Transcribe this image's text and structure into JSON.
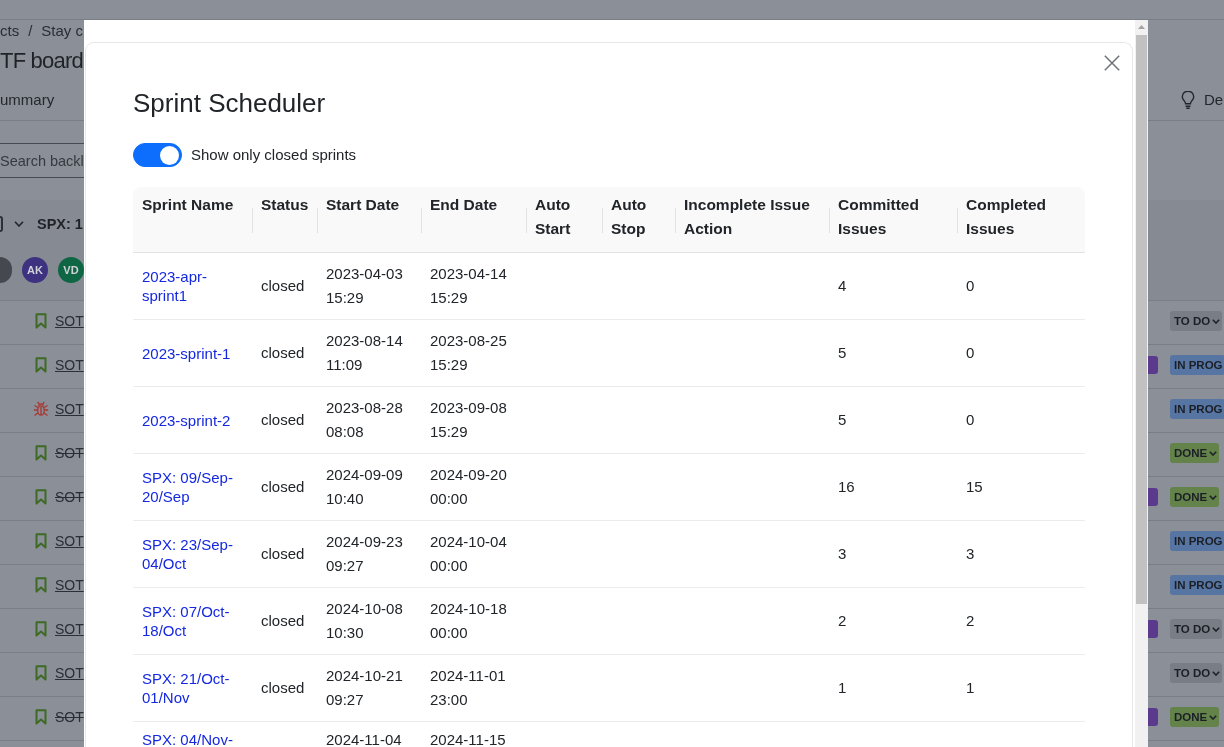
{
  "background_page": {
    "breadcrumb": {
      "items": [
        "cts",
        "Stay c"
      ],
      "separator": "/"
    },
    "board_title": "TF board",
    "nav_tabs": {
      "left": "ummary",
      "right": "De"
    },
    "search": {
      "placeholder": "Search backl"
    },
    "sprint": {
      "title": "SPX: 1",
      "expanded": true,
      "checked": false
    },
    "avatars": [
      {
        "kind": "photo"
      },
      {
        "kind": "initials",
        "initials": "AK",
        "color": "#3d3180"
      },
      {
        "kind": "initials",
        "initials": "VD",
        "color": "#0f6644"
      }
    ],
    "issues": [
      {
        "kind": "story",
        "key": "SOT",
        "done": false,
        "tagged": false,
        "status": {
          "label": "TO DO",
          "color": "#787d86",
          "dropdown": true
        }
      },
      {
        "kind": "story",
        "key": "SOT",
        "done": false,
        "tagged": true,
        "status": {
          "label": "IN PROG",
          "color": "#5675a2",
          "dropdown": false
        }
      },
      {
        "kind": "bug",
        "key": "SOT",
        "done": false,
        "tagged": false,
        "status": {
          "label": "IN PROG",
          "color": "#5675a2",
          "dropdown": false
        }
      },
      {
        "kind": "story",
        "key": "SOT",
        "done": true,
        "tagged": false,
        "status": {
          "label": "DONE",
          "color": "#64834b",
          "dropdown": true
        }
      },
      {
        "kind": "story",
        "key": "SOT",
        "done": true,
        "tagged": true,
        "status": {
          "label": "DONE",
          "color": "#64834b",
          "dropdown": true
        }
      },
      {
        "kind": "story",
        "key": "SOT",
        "done": false,
        "tagged": false,
        "status": {
          "label": "IN PROG",
          "color": "#5675a2",
          "dropdown": false
        }
      },
      {
        "kind": "story",
        "key": "SOT",
        "done": false,
        "tagged": false,
        "status": {
          "label": "IN PROG",
          "color": "#5675a2",
          "dropdown": false
        }
      },
      {
        "kind": "story",
        "key": "SOT",
        "done": false,
        "tagged": true,
        "status": {
          "label": "TO DO",
          "color": "#787d86",
          "dropdown": true
        }
      },
      {
        "kind": "story",
        "key": "SOT",
        "done": false,
        "tagged": false,
        "status": {
          "label": "TO DO",
          "color": "#787d86",
          "dropdown": true
        }
      },
      {
        "kind": "story",
        "key": "SOT",
        "done": true,
        "tagged": true,
        "status": {
          "label": "DONE",
          "color": "#64834b",
          "dropdown": true
        }
      }
    ]
  },
  "modal": {
    "title": "Sprint Scheduler",
    "toggle": {
      "label": "Show only closed sprints",
      "on": true
    },
    "table": {
      "columns": [
        "Sprint Name",
        "Status",
        "Start Date",
        "End Date",
        "Auto Start",
        "Auto Stop",
        "Incomplete Issue Action",
        "Committed Issues",
        "Completed Issues"
      ],
      "rows": [
        {
          "sprint_name": "2023-apr-sprint1",
          "status": "closed",
          "start_date": "2023-04-03 15:29",
          "end_date": "2023-04-14 15:29",
          "committed_issues": "4",
          "completed_issues": "0"
        },
        {
          "sprint_name": "2023-sprint-1",
          "status": "closed",
          "start_date": "2023-08-14 11:09",
          "end_date": "2023-08-25 15:29",
          "committed_issues": "5",
          "completed_issues": "0"
        },
        {
          "sprint_name": "2023-sprint-2",
          "status": "closed",
          "start_date": "2023-08-28 08:08",
          "end_date": "2023-09-08 15:29",
          "committed_issues": "5",
          "completed_issues": "0"
        },
        {
          "sprint_name": "SPX: 09/Sep-20/Sep",
          "status": "closed",
          "start_date": "2024-09-09 10:40",
          "end_date": "2024-09-20 00:00",
          "committed_issues": "16",
          "completed_issues": "15"
        },
        {
          "sprint_name": "SPX: 23/Sep-04/Oct",
          "status": "closed",
          "start_date": "2024-09-23 09:27",
          "end_date": "2024-10-04 00:00",
          "committed_issues": "3",
          "completed_issues": "3"
        },
        {
          "sprint_name": "SPX: 07/Oct-18/Oct",
          "status": "closed",
          "start_date": "2024-10-08 10:30",
          "end_date": "2024-10-18 00:00",
          "committed_issues": "2",
          "completed_issues": "2"
        },
        {
          "sprint_name": "SPX: 21/Oct-01/Nov",
          "status": "closed",
          "start_date": "2024-10-21 09:27",
          "end_date": "2024-11-01 23:00",
          "committed_issues": "1",
          "completed_issues": "1"
        },
        {
          "sprint_name": "SPX: 04/Nov-",
          "start_date": "2024-11-04",
          "end_date": "2024-11-15"
        }
      ]
    }
  }
}
